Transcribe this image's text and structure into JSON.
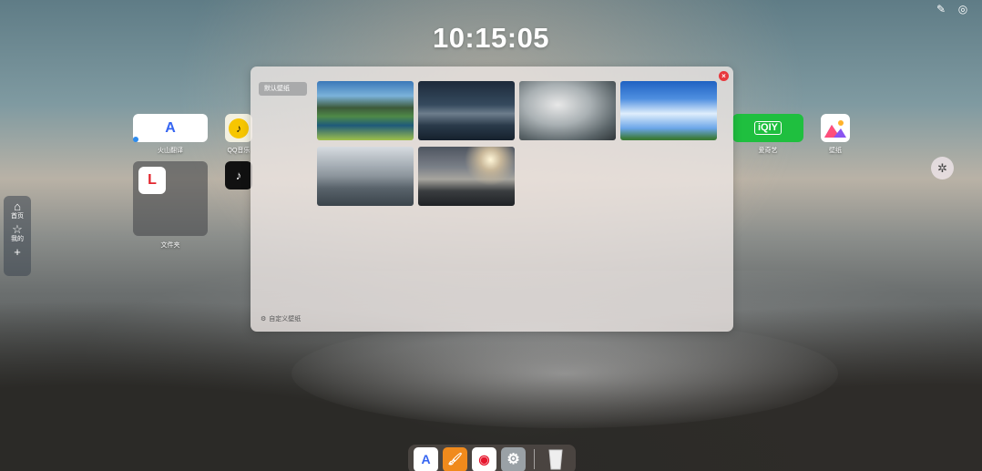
{
  "system_tray": {
    "edit_icon": "edit-icon",
    "user_icon": "user-circle-icon"
  },
  "clock": {
    "time": "10:15:05"
  },
  "sidebar": {
    "items": [
      {
        "label": "首页",
        "icon": "⌂"
      },
      {
        "label": "我的",
        "icon": "☆"
      },
      {
        "label": "",
        "icon": "+"
      }
    ]
  },
  "desktop_apps": [
    {
      "label": "火山翻译",
      "glyph": "A"
    },
    {
      "label": "QQ音乐",
      "glyph": "♪"
    },
    {
      "label": "爱奇艺",
      "glyph": "iQIY"
    },
    {
      "label": "壁纸",
      "glyph": ""
    }
  ],
  "folder": {
    "label": "文件夹",
    "glyph": "L"
  },
  "wallpaper_panel": {
    "category": "默认壁纸",
    "upload_label": "自定义壁纸",
    "close_glyph": "×",
    "thumbnails": [
      "lake-mountains",
      "misty-hills",
      "ice-texture",
      "blue-sky",
      "cloud-sea",
      "sunset-coast"
    ]
  },
  "dock": {
    "apps": [
      {
        "name": "火山翻译",
        "glyph": "A",
        "color": "#ffffff"
      },
      {
        "name": "paint",
        "glyph": "🖌",
        "color": "#f08a1c"
      },
      {
        "name": "weibo",
        "glyph": "◉",
        "color": "#ffffff"
      },
      {
        "name": "settings",
        "glyph": "⚙",
        "color": "#9aa1a6"
      },
      {
        "name": "trash",
        "glyph": "",
        "color": "#e6e6e6"
      }
    ]
  }
}
